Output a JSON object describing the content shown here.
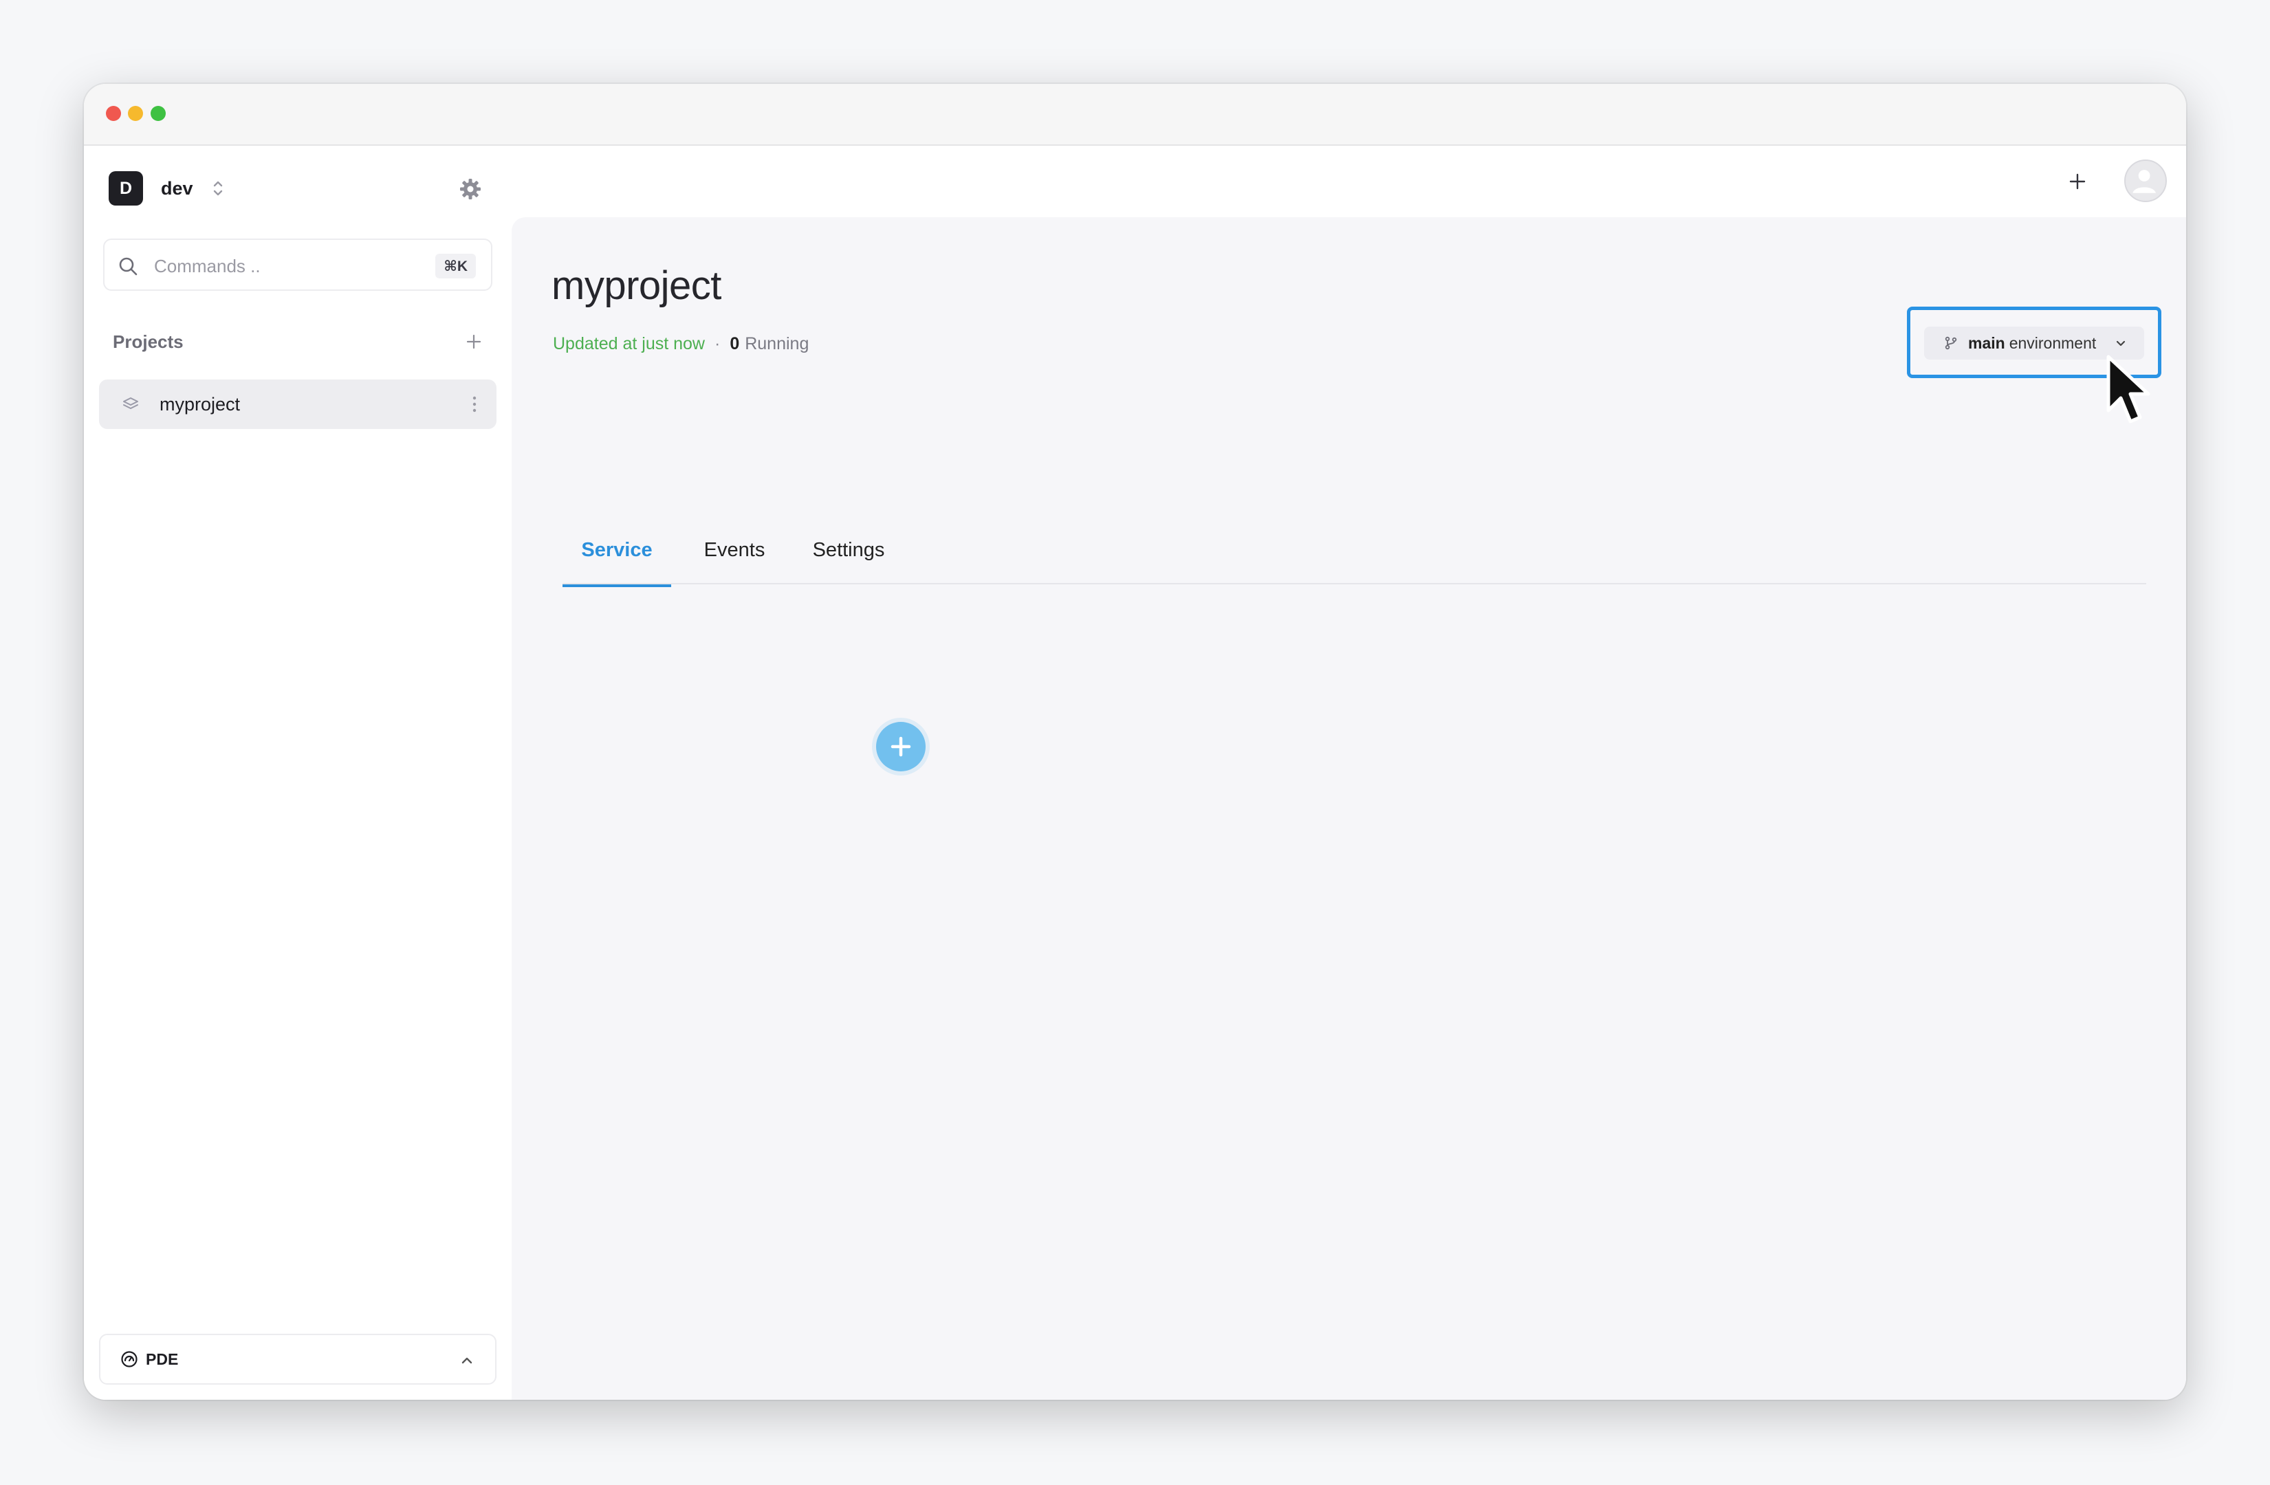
{
  "workspace": {
    "avatar_letter": "D",
    "name": "dev"
  },
  "search": {
    "placeholder": "Commands ..",
    "shortcut": "⌘K"
  },
  "sidebar": {
    "projects_title": "Projects",
    "projects": [
      {
        "name": "myproject"
      }
    ],
    "bottom_label": "PDE"
  },
  "main": {
    "title": "myproject",
    "status": {
      "updated": "Updated at just now",
      "separator": "·",
      "running_count": "0",
      "running_label": "Running"
    },
    "environment": {
      "name": "main",
      "suffix": "environment"
    },
    "tabs": [
      {
        "label": "Service"
      },
      {
        "label": "Events"
      },
      {
        "label": "Settings"
      }
    ],
    "active_tab": "Service"
  },
  "colors": {
    "accent": "#2b8fdb",
    "updated_status": "#4caf50",
    "add_service_button": "#72c0ee"
  },
  "icons": {
    "traffic_lights": [
      "close",
      "minimize",
      "maximize"
    ],
    "workspace_switch": "chevron-up-down-icon",
    "settings": "gear-icon",
    "search": "search-icon",
    "add_project": "plus-icon",
    "project": "layers-icon",
    "project_menu": "kebab-icon",
    "bottom": "gauge-icon",
    "bottom_toggle": "chevron-up-icon",
    "top_add": "plus-icon",
    "user": "user-avatar-icon",
    "environment": "git-branch-icon",
    "environment_toggle": "chevron-down-icon",
    "add_service": "plus-icon"
  }
}
